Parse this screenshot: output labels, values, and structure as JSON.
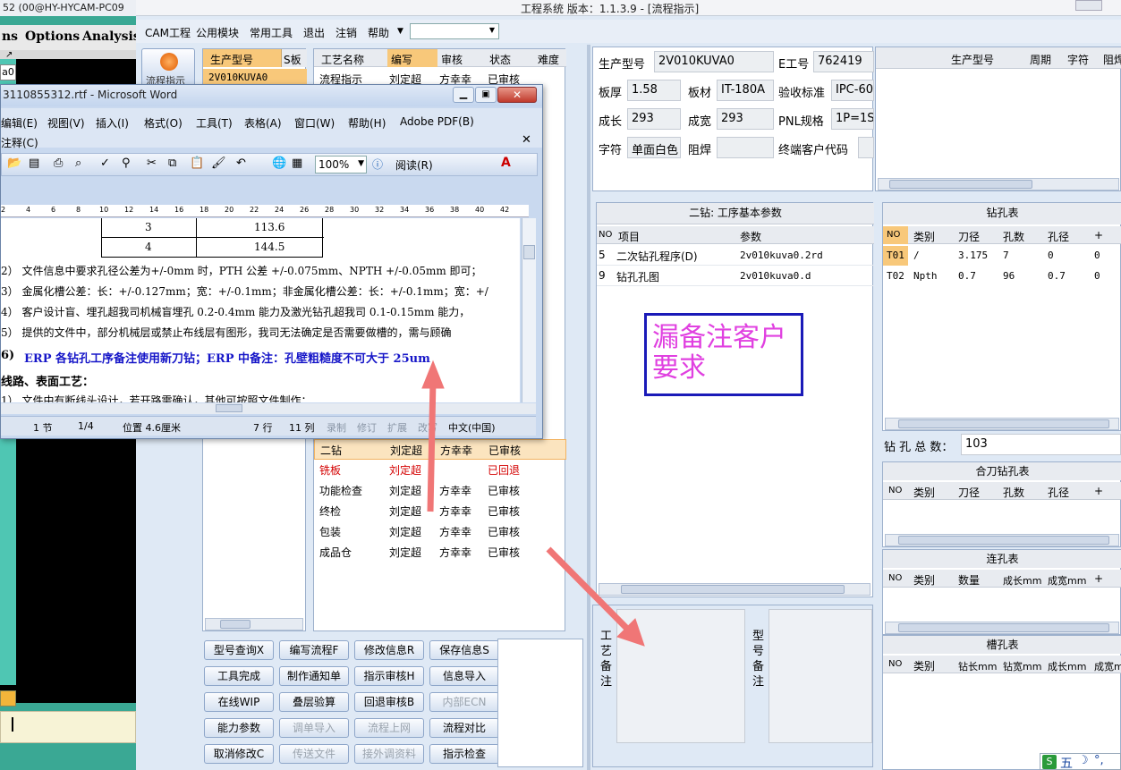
{
  "back_app": {
    "title": "52 (00@HY-HYCAM-PC09",
    "menu": [
      "ns",
      "Options",
      "Analysis"
    ],
    "field_value": "a0"
  },
  "main_app": {
    "title": "工程系统   版本：1.1.3.9 - [流程指示]",
    "menu": [
      "CAM工程",
      "公用模块",
      "常用工具",
      "退出",
      "注销",
      "帮助"
    ],
    "flow_button": "流程指示",
    "model_table": {
      "headers": [
        "生产型号",
        "S板"
      ],
      "rows": [
        [
          "2V010KUVA0",
          ""
        ]
      ]
    },
    "process_table": {
      "headers": [
        "工艺名称",
        "编写",
        "审核",
        "状态",
        "难度"
      ],
      "rows": [
        {
          "name": "流程指示",
          "writer": "刘定超",
          "reviewer": "方幸幸",
          "status": "已审核",
          "red": false,
          "hl": false
        },
        {
          "name": "二钻",
          "writer": "刘定超",
          "reviewer": "方幸幸",
          "status": "已审核",
          "red": false,
          "hl": true
        },
        {
          "name": "铣板",
          "writer": "刘定超",
          "reviewer": "",
          "status": "已回退",
          "red": true,
          "hl": false
        },
        {
          "name": "功能检查",
          "writer": "刘定超",
          "reviewer": "方幸幸",
          "status": "已审核",
          "red": false,
          "hl": false
        },
        {
          "name": "终检",
          "writer": "刘定超",
          "reviewer": "方幸幸",
          "status": "已审核",
          "red": false,
          "hl": false
        },
        {
          "name": "包装",
          "writer": "刘定超",
          "reviewer": "方幸幸",
          "status": "已审核",
          "red": false,
          "hl": false
        },
        {
          "name": "成品仓",
          "writer": "刘定超",
          "reviewer": "方幸幸",
          "status": "已审核",
          "red": false,
          "hl": false
        }
      ]
    },
    "buttons": [
      {
        "label": "型号查询X",
        "disabled": false
      },
      {
        "label": "编写流程F",
        "disabled": false
      },
      {
        "label": "修改信息R",
        "disabled": false
      },
      {
        "label": "保存信息S",
        "disabled": false
      },
      {
        "label": "工具完成",
        "disabled": false
      },
      {
        "label": "制作通知单",
        "disabled": false
      },
      {
        "label": "指示审核H",
        "disabled": false
      },
      {
        "label": "信息导入",
        "disabled": false
      },
      {
        "label": "在线WIP",
        "disabled": false
      },
      {
        "label": "叠层验算",
        "disabled": false
      },
      {
        "label": "回退审核B",
        "disabled": false
      },
      {
        "label": "内部ECN",
        "disabled": true
      },
      {
        "label": "能力参数",
        "disabled": false
      },
      {
        "label": "调单导入",
        "disabled": true
      },
      {
        "label": "流程上网",
        "disabled": true
      },
      {
        "label": "流程对比",
        "disabled": false
      },
      {
        "label": "取消修改C",
        "disabled": false
      },
      {
        "label": "传送文件",
        "disabled": true
      },
      {
        "label": "接外调资料",
        "disabled": true
      },
      {
        "label": "指示检查",
        "disabled": false
      }
    ],
    "info": {
      "model_label": "生产型号",
      "model_value": "2V010KUVA0",
      "eno_label": "E工号",
      "eno_value": "762419",
      "thick_label": "板厚",
      "thick_value": "1.58",
      "mat_label": "板材",
      "mat_value": "IT-180A",
      "std_label": "验收标准",
      "std_value": "IPC-60",
      "len_label": "成长",
      "len_value": "293",
      "wid_label": "成宽",
      "wid_value": "293",
      "pnl_label": "PNL规格",
      "pnl_value": "1P=1S",
      "char_label": "字符",
      "char_value": "单面白色",
      "mask_label": "阻焊",
      "mask_value": "",
      "cust_label": "终端客户代码",
      "cust_value": ""
    },
    "mini_table_headers": [
      "生产型号",
      "周期",
      "字符",
      "阻焊"
    ],
    "drill_params": {
      "title": "二钻: 工序基本参数",
      "headers": [
        "NO",
        "项目",
        "参数"
      ],
      "rows": [
        [
          "5",
          "二次钻孔程序(D)",
          "2v010kuva0.2rd"
        ],
        [
          "9",
          "钻孔孔图",
          "2v010kuva0.d"
        ]
      ]
    },
    "annotation": "漏备注客户要求",
    "drill_table": {
      "title": "钻孔表",
      "headers": [
        "NO",
        "类别",
        "刀径",
        "孔数",
        "孔径",
        "+"
      ],
      "rows": [
        [
          "T01",
          "/",
          "3.175",
          "7",
          "0",
          "0"
        ],
        [
          "T02",
          "Npth",
          "0.7",
          "96",
          "0.7",
          "0"
        ]
      ]
    },
    "hole_total_label": "钻 孔 总 数：",
    "hole_total_value": "103",
    "combo_table": {
      "title": "合刀钻孔表",
      "headers": [
        "NO",
        "类别",
        "刀径",
        "孔数",
        "孔径",
        "+"
      ]
    },
    "link_table": {
      "title": "连孔表",
      "headers": [
        "NO",
        "类别",
        "数量",
        "成长mm",
        "成宽mm",
        "+"
      ]
    },
    "slot_table": {
      "title": "槽孔表",
      "headers": [
        "NO",
        "类别",
        "钻长mm",
        "钻宽mm",
        "成长mm",
        "成宽mm"
      ]
    },
    "process_note_label": "工艺备注",
    "model_note_label": "型号备注"
  },
  "word": {
    "title": "3110855312.rtf - Microsoft Word",
    "menu": [
      "编辑(E)",
      "视图(V)",
      "插入(I)",
      "格式(O)",
      "工具(T)",
      "表格(A)",
      "窗口(W)",
      "帮助(H)",
      "Adobe PDF(B)"
    ],
    "menu2": "注释(C)",
    "zoom": "100%",
    "reading": "阅读(R)",
    "ruler": [
      "2",
      "4",
      "6",
      "8",
      "10",
      "12",
      "14",
      "16",
      "18",
      "20",
      "22",
      "24",
      "26",
      "28",
      "30",
      "32",
      "34",
      "36",
      "38",
      "40",
      "42"
    ],
    "table_rows": [
      [
        "3",
        "113.6"
      ],
      [
        "4",
        "144.5"
      ]
    ],
    "lines": [
      "2）  文件信息中要求孔径公差为+/-0mm 时，PTH 公差 +/-0.075mm、NPTH +/-0.05mm 即可；",
      "3）  金属化槽公差：长：+/-0.127mm；宽：+/-0.1mm；非金属化槽公差：长：+/-0.1mm；宽：+/",
      "4）  客户设计盲、埋孔超我司机械盲埋孔 0.2-0.4mm 能力及激光钻孔超我司 0.1-0.15mm 能力，",
      "5）  提供的文件中，部分机械层或禁止布线层有图形，我司无法确定是否需要做槽的，需与顾确"
    ],
    "erp_num": "6)",
    "erp_line": "ERP 各钻孔工序备注使用新刀钻；ERP 中备注：孔壁粗糙度不可大于 25um",
    "section_title": "线路、表面工艺：",
    "last_line": "1）  文件中有断线头设计，若开路需确认，其他可按照文件制作：",
    "status": {
      "section": "1 节",
      "page": "1/4",
      "pos": "位置 4.6厘米",
      "row": "7 行",
      "col": "11 列",
      "rec": "录制",
      "trk": "修订",
      "ext": "扩展",
      "ovr": "改写",
      "lang": "中文(中国)"
    }
  },
  "tray": {
    "ime": "五"
  }
}
